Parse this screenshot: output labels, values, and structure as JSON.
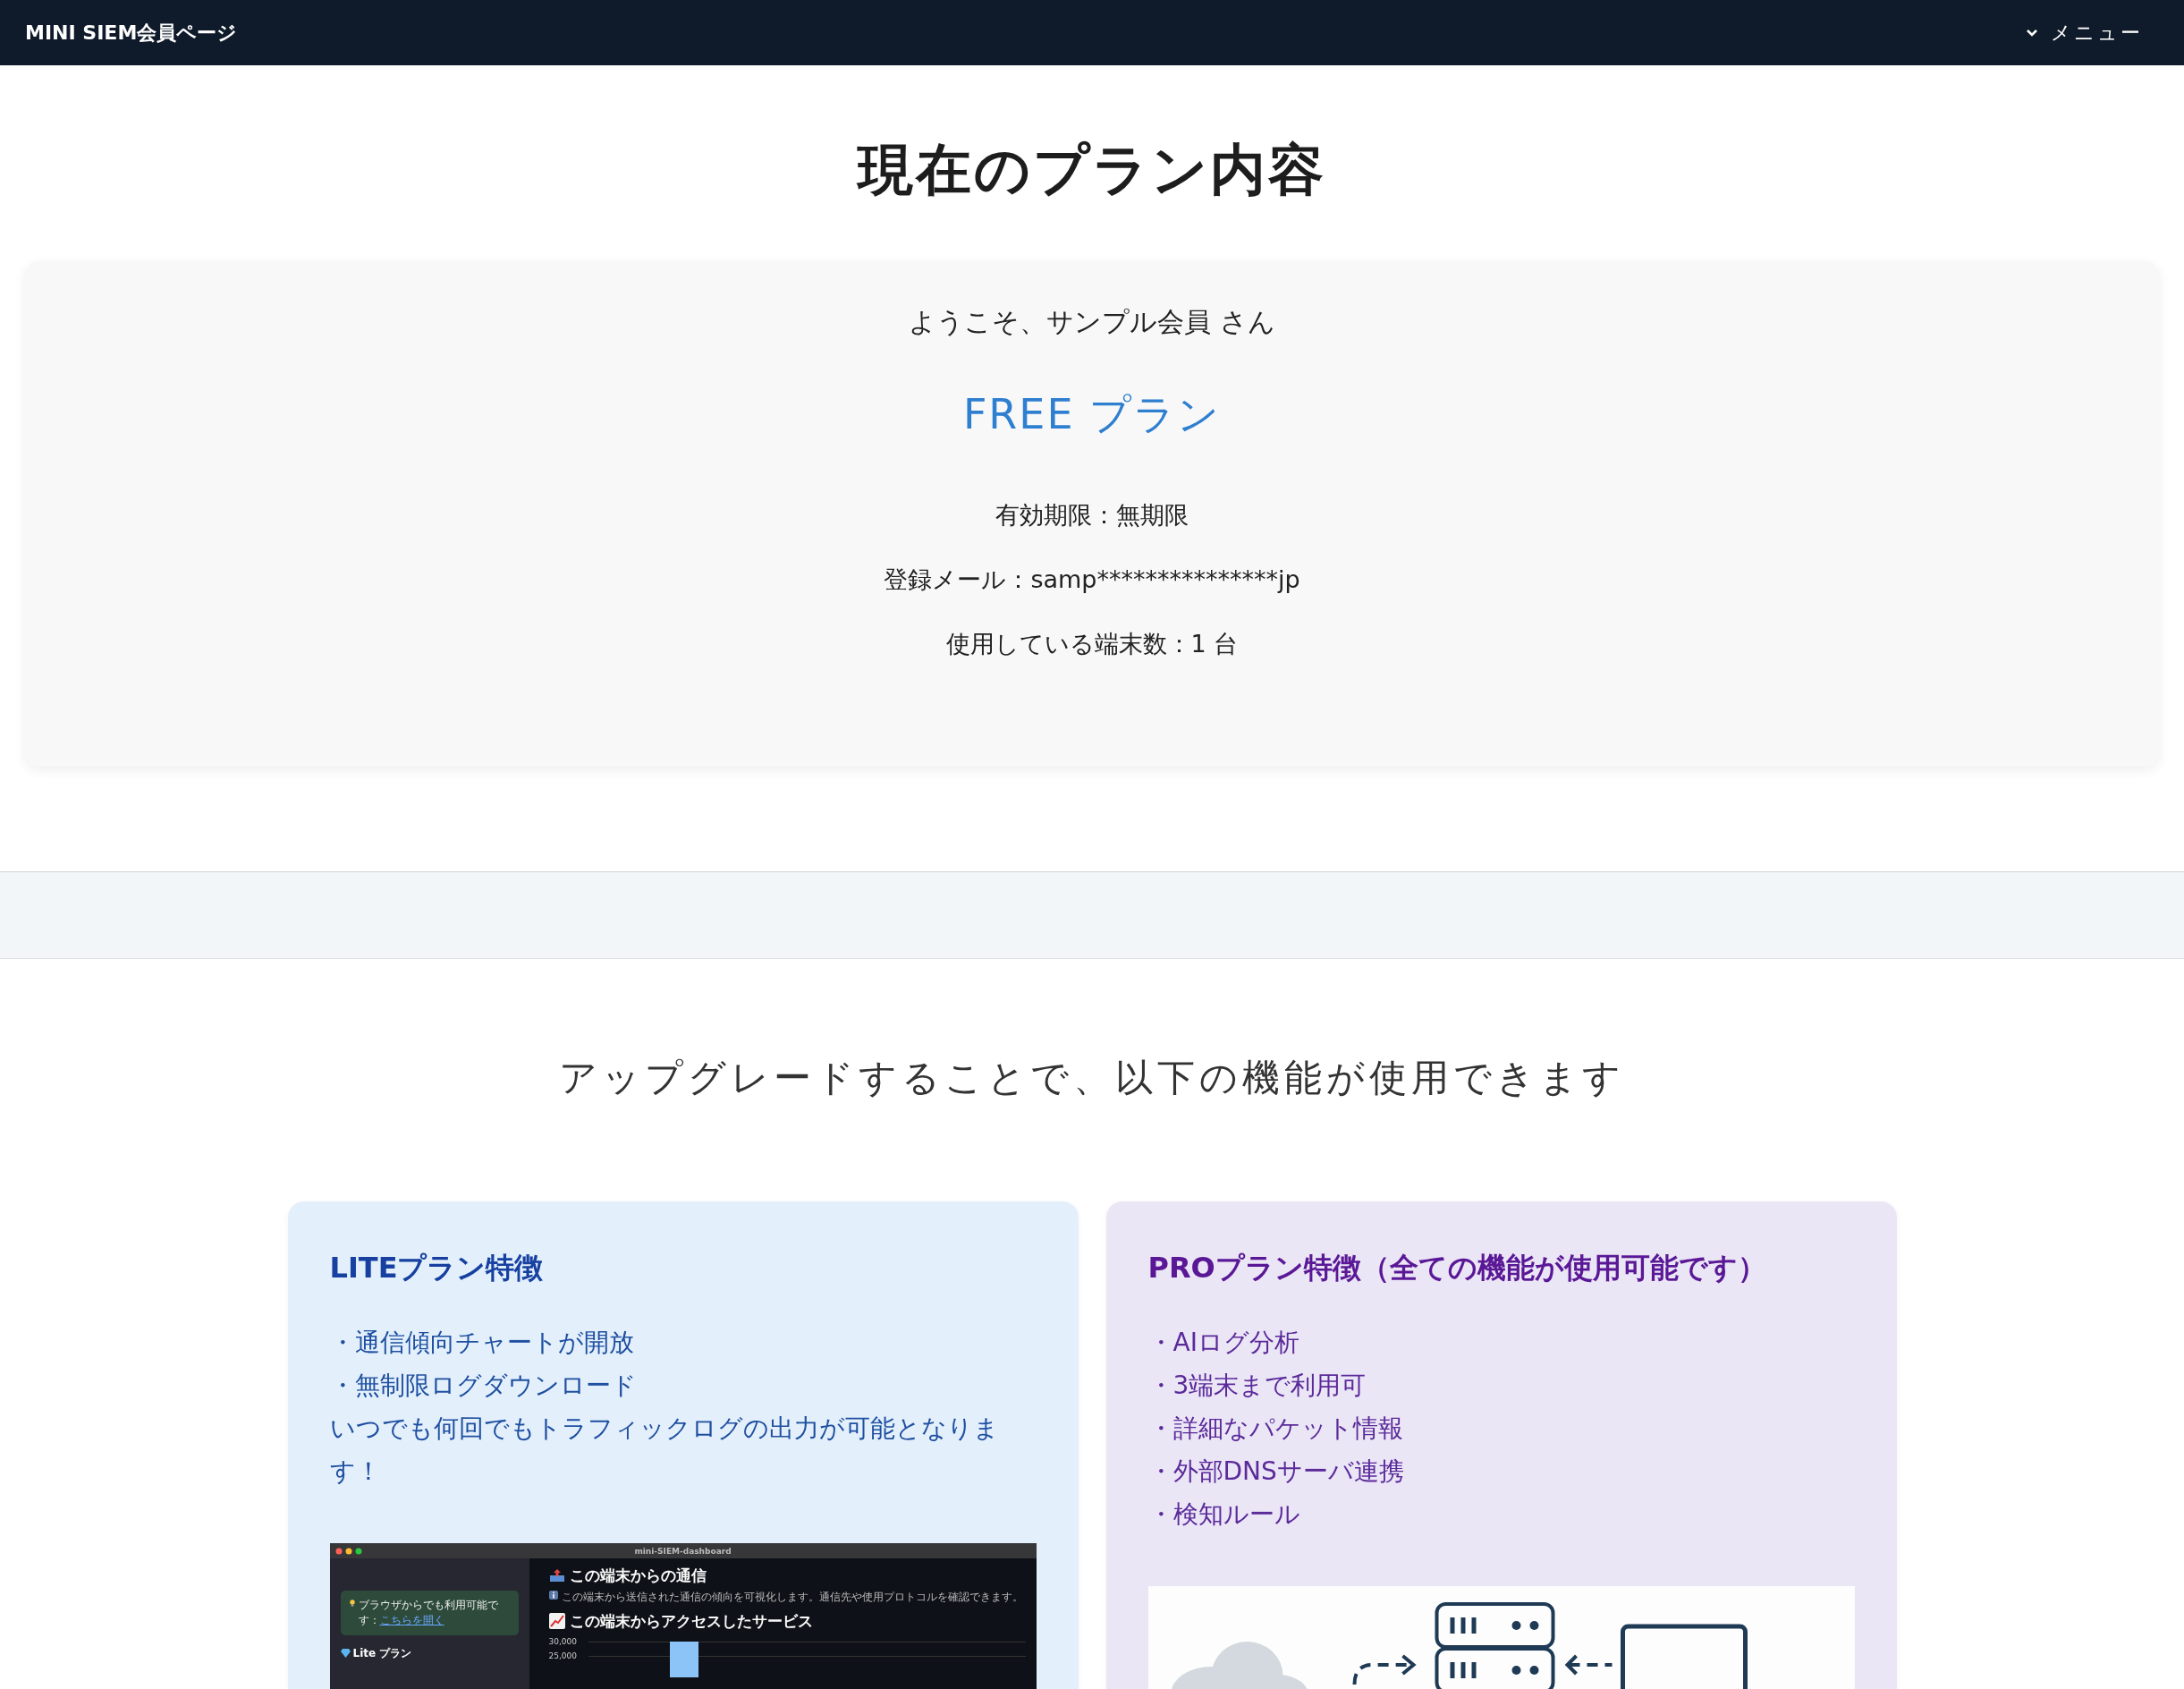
{
  "header": {
    "title": "MINI SIEM会員ページ",
    "menu": "メニュー"
  },
  "page_title": "現在のプラン内容",
  "plan_card": {
    "welcome": "ようこそ、サンプル会員 さん",
    "plan": "FREE プラン",
    "details": [
      "有効期限：無期限",
      "登録メール：samp***************jp",
      "使用している端末数：1 台"
    ]
  },
  "upgrade_heading": "アップグレードすることで、以下の機能が使用できます",
  "plans": [
    {
      "kind": "lite",
      "title": "LITEプラン特徴",
      "items": [
        "・通信傾向チャートが開放",
        "・無制限ログダウンロード",
        "いつでも何回でもトラフィックログの出力が可能となります！"
      ],
      "figure": {
        "kind": "app-window",
        "window_title": "mini-SIEM-dashboard",
        "sidebar_notice": "ブラウザからでも利用可能です：",
        "sidebar_link": "こちらを開く",
        "sidebar_plan": "Lite プラン",
        "heading_1": "この端末からの通信",
        "note": "この端末から送信された通信の傾向を可視化します。通信先や使用プロトコルを確認できます。",
        "heading_2": "この端末からアクセスしたサービス",
        "axis_labels": [
          "30,000",
          "25,000"
        ]
      }
    },
    {
      "kind": "pro",
      "title": "PROプラン特徴（全ての機能が使用可能です）",
      "items": [
        "・AIログ分析",
        "・3端末まで利用可",
        "・詳細なパケット情報",
        "・外部DNSサーバ連携",
        "・検知ルール"
      ],
      "figure": {
        "kind": "diagram"
      }
    }
  ]
}
